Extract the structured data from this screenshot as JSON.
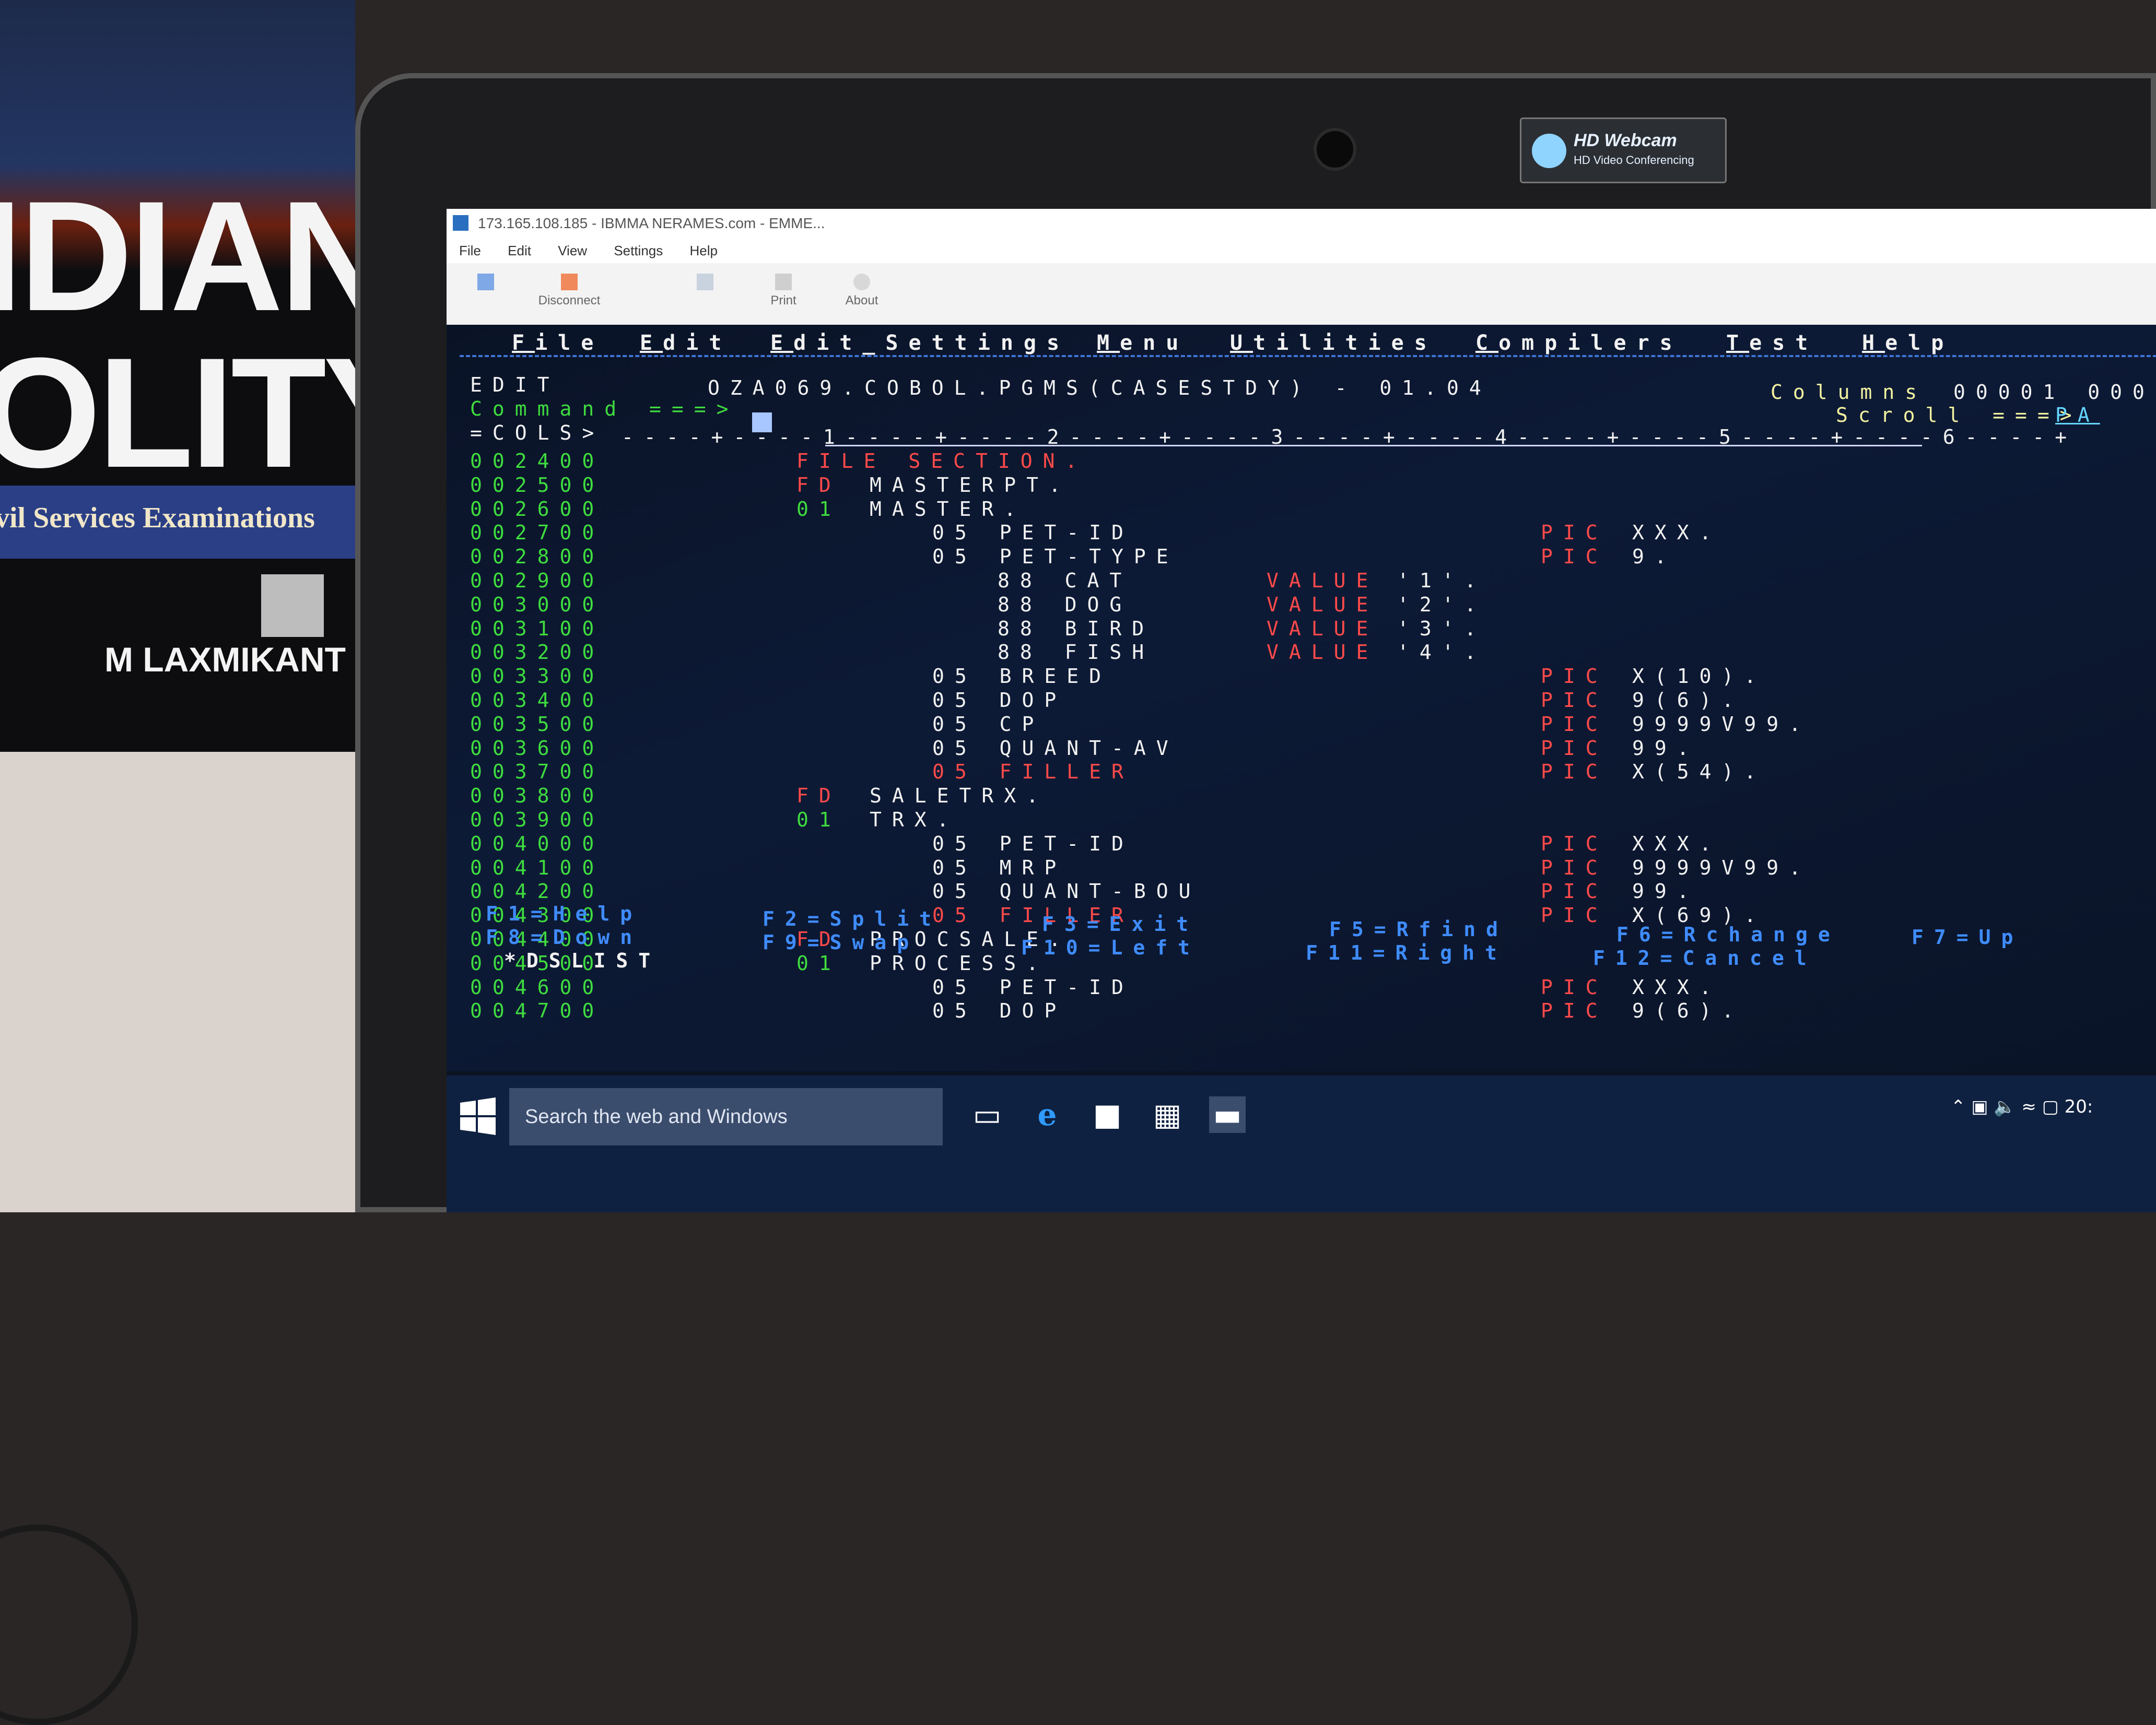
{
  "book": {
    "title_line1": "IDIAN",
    "title_line2": "OLITY",
    "subtitle": "vil Services Examinations",
    "author": "M LAXMIKANT"
  },
  "webcam": {
    "title": "HD Webcam",
    "subtitle": "HD Video Conferencing"
  },
  "window": {
    "title": "173.165.108.185 - IBMMA NERAMES.com - EMME..."
  },
  "menubar": [
    "File",
    "Edit",
    "View",
    "Settings",
    "Help"
  ],
  "toolbar": {
    "disconnect_label": "Disconnect",
    "print_label": "Print",
    "about_label": "About"
  },
  "ispf_menu": [
    {
      "ul": "F",
      "rest": "ile"
    },
    {
      "ul": "E",
      "rest": "dit"
    },
    {
      "ul": "E",
      "rest": "dit_Settings"
    },
    {
      "ul": "M",
      "rest": "enu"
    },
    {
      "ul": "U",
      "rest": "tilities"
    },
    {
      "ul": "C",
      "rest": "ompilers"
    },
    {
      "ul": "T",
      "rest": "est"
    },
    {
      "ul": "H",
      "rest": "elp"
    }
  ],
  "header": {
    "mode": "EDIT",
    "dataset": "OZA069.COBOL.PGMS(CASESTDY) - 01.04",
    "columns_label": "Columns",
    "columns_value": "00001 000",
    "command_label": "Command ===>",
    "scroll_label": "Scroll ===>",
    "scroll_value": "PA",
    "cols_label": "=COLS>",
    "cols_ruler": "----+----1----+----2----+----3----+----4----+----5----+----6----+"
  },
  "source_lines": [
    {
      "seq": "002400",
      "a": "",
      "b": "FILE SECTION.",
      "pic": "",
      "picv": "",
      "val": "",
      "valv": ""
    },
    {
      "seq": "002500",
      "a": "FD",
      "b": "MASTERPT.",
      "pic": "",
      "picv": "",
      "val": "",
      "valv": ""
    },
    {
      "seq": "002600",
      "a": "01",
      "b": "MASTER.",
      "pic": "",
      "picv": "",
      "val": "",
      "valv": ""
    },
    {
      "seq": "002700",
      "a": "",
      "b": "05 PET-ID",
      "pic": "PIC",
      "picv": "XXX.",
      "val": "",
      "valv": ""
    },
    {
      "seq": "002800",
      "a": "",
      "b": "05 PET-TYPE",
      "pic": "PIC",
      "picv": "9.",
      "val": "",
      "valv": ""
    },
    {
      "seq": "002900",
      "a": "",
      "b": "88 CAT",
      "pic": "",
      "picv": "",
      "val": "VALUE",
      "valv": "'1'."
    },
    {
      "seq": "003000",
      "a": "",
      "b": "88 DOG",
      "pic": "",
      "picv": "",
      "val": "VALUE",
      "valv": "'2'."
    },
    {
      "seq": "003100",
      "a": "",
      "b": "88 BIRD",
      "pic": "",
      "picv": "",
      "val": "VALUE",
      "valv": "'3'."
    },
    {
      "seq": "003200",
      "a": "",
      "b": "88 FISH",
      "pic": "",
      "picv": "",
      "val": "VALUE",
      "valv": "'4'."
    },
    {
      "seq": "003300",
      "a": "",
      "b": "05 BREED",
      "pic": "PIC",
      "picv": "X(10).",
      "val": "",
      "valv": ""
    },
    {
      "seq": "003400",
      "a": "",
      "b": "05 DOP",
      "pic": "PIC",
      "picv": "9(6).",
      "val": "",
      "valv": ""
    },
    {
      "seq": "003500",
      "a": "",
      "b": "05 CP",
      "pic": "PIC",
      "picv": "9999V99.",
      "val": "",
      "valv": ""
    },
    {
      "seq": "003600",
      "a": "",
      "b": "05 QUANT-AV",
      "pic": "PIC",
      "picv": "99.",
      "val": "",
      "valv": ""
    },
    {
      "seq": "003700",
      "a": "",
      "b": "05 FILLER",
      "pic": "PIC",
      "picv": "X(54).",
      "val": "",
      "valv": ""
    },
    {
      "seq": "003800",
      "a": "FD",
      "b": "SALETRX.",
      "pic": "",
      "picv": "",
      "val": "",
      "valv": ""
    },
    {
      "seq": "003900",
      "a": "01",
      "b": "TRX.",
      "pic": "",
      "picv": "",
      "val": "",
      "valv": ""
    },
    {
      "seq": "004000",
      "a": "",
      "b": "05 PET-ID",
      "pic": "PIC",
      "picv": "XXX.",
      "val": "",
      "valv": ""
    },
    {
      "seq": "004100",
      "a": "",
      "b": "05 MRP",
      "pic": "PIC",
      "picv": "9999V99.",
      "val": "",
      "valv": ""
    },
    {
      "seq": "004200",
      "a": "",
      "b": "05 QUANT-BOU",
      "pic": "PIC",
      "picv": "99.",
      "val": "",
      "valv": ""
    },
    {
      "seq": "004300",
      "a": "",
      "b": "05 FILLER",
      "pic": "PIC",
      "picv": "X(69).",
      "val": "",
      "valv": ""
    },
    {
      "seq": "004400",
      "a": "FD",
      "b": "PROCSALE.",
      "pic": "",
      "picv": "",
      "val": "",
      "valv": ""
    },
    {
      "seq": "004500",
      "a": "01",
      "b": "PROCESS.",
      "pic": "",
      "picv": "",
      "val": "",
      "valv": ""
    },
    {
      "seq": "004600",
      "a": "",
      "b": "05 PET-ID",
      "pic": "PIC",
      "picv": "XXX.",
      "val": "",
      "valv": ""
    },
    {
      "seq": "004700",
      "a": "",
      "b": "05 DOP",
      "pic": "PIC",
      "picv": "9(6).",
      "val": "",
      "valv": ""
    }
  ],
  "fkeys": {
    "f1": "F1=Help",
    "f2": "F2=Split",
    "f3": "F3=Exit",
    "f5": "F5=Rfind",
    "f6": "F6=Rchange",
    "f7": "F7=Up",
    "f8": "F8=Down",
    "f9": "F9=Swap",
    "f10": "F10=Left",
    "f11": "F11=Right",
    "f12": "F12=Cancel",
    "dslist": "*DSLIST"
  },
  "taskbar": {
    "search_placeholder": "Search the web and Windows",
    "clock": "20:"
  },
  "colors": {
    "seq": "#3fdc3f",
    "keyword": "#ff4a4a",
    "text": "#f2f2f2",
    "fkey": "#3f8cff"
  }
}
